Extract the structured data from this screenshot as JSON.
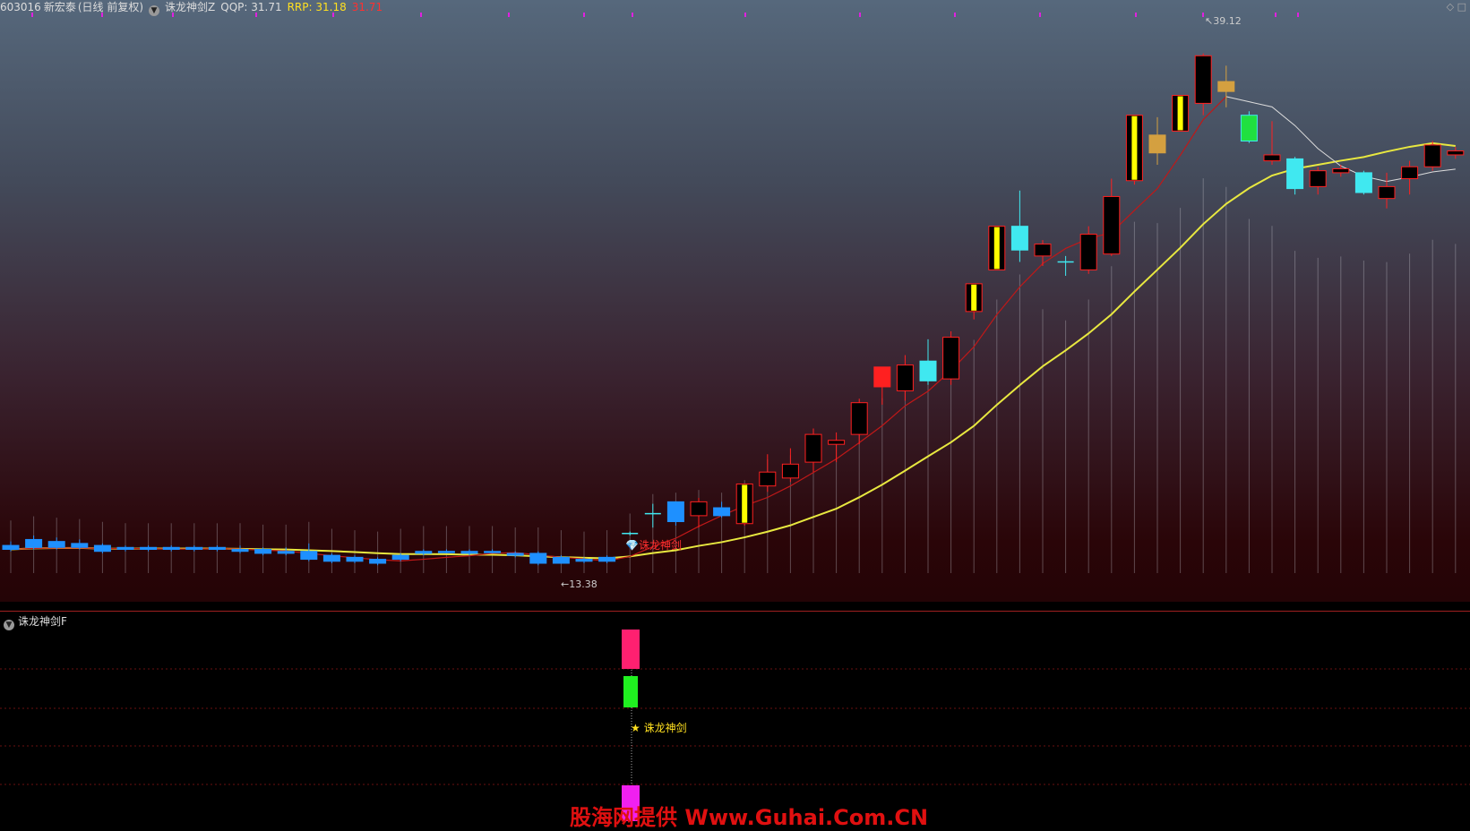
{
  "header": {
    "stock_code": "603016",
    "stock_name": "新宏泰",
    "period": "(日线 前复权)",
    "indicator": "诛龙神剑Z",
    "qqp_label": "QQP: 31.71",
    "rrp_label": "RRP: 31.18",
    "extra_value": "31.71"
  },
  "main_chart": {
    "high_label": "39.12",
    "low_label": "13.38",
    "signal_label": "诛龙神剑"
  },
  "sub_panel": {
    "title": "诛龙神剑F",
    "signal_label": "诛龙神剑"
  },
  "watermark": "股海网提供 Www.Guhai.Com.CN",
  "colors": {
    "up": "#ff2020",
    "down_blue": "#1e90ff",
    "cyan": "#40e8f0",
    "yellow_bar": "#ffff00",
    "ma_yellow": "#e8e840",
    "ma_red": "#c01818",
    "accent_magenta": "#e020e0"
  },
  "chart_data": {
    "type": "candlestick",
    "ylim": [
      12.0,
      41.0
    ],
    "candles": [
      {
        "o": 14.3,
        "c": 14.1,
        "h": 14.5,
        "l": 14.0,
        "kind": "down"
      },
      {
        "o": 14.6,
        "c": 14.2,
        "h": 14.8,
        "l": 14.1,
        "kind": "down"
      },
      {
        "o": 14.5,
        "c": 14.2,
        "h": 14.7,
        "l": 14.1,
        "kind": "down"
      },
      {
        "o": 14.4,
        "c": 14.2,
        "h": 14.6,
        "l": 14.1,
        "kind": "down"
      },
      {
        "o": 14.3,
        "c": 14.0,
        "h": 14.4,
        "l": 13.9,
        "kind": "down"
      },
      {
        "o": 14.2,
        "c": 14.1,
        "h": 14.3,
        "l": 14.0,
        "kind": "down"
      },
      {
        "o": 14.1,
        "c": 14.2,
        "h": 14.3,
        "l": 14.0,
        "kind": "down"
      },
      {
        "o": 14.2,
        "c": 14.1,
        "h": 14.3,
        "l": 14.0,
        "kind": "down"
      },
      {
        "o": 14.1,
        "c": 14.2,
        "h": 14.3,
        "l": 14.0,
        "kind": "down"
      },
      {
        "o": 14.2,
        "c": 14.1,
        "h": 14.3,
        "l": 14.0,
        "kind": "down"
      },
      {
        "o": 14.1,
        "c": 14.0,
        "h": 14.3,
        "l": 13.9,
        "kind": "down"
      },
      {
        "o": 14.1,
        "c": 13.9,
        "h": 14.2,
        "l": 13.8,
        "kind": "down"
      },
      {
        "o": 14.0,
        "c": 13.9,
        "h": 14.2,
        "l": 13.8,
        "kind": "down"
      },
      {
        "o": 14.0,
        "c": 13.6,
        "h": 14.4,
        "l": 13.5,
        "kind": "down"
      },
      {
        "o": 13.8,
        "c": 13.5,
        "h": 13.9,
        "l": 13.4,
        "kind": "down"
      },
      {
        "o": 13.7,
        "c": 13.5,
        "h": 13.8,
        "l": 13.4,
        "kind": "down"
      },
      {
        "o": 13.6,
        "c": 13.4,
        "h": 13.7,
        "l": 13.3,
        "kind": "down"
      },
      {
        "o": 13.8,
        "c": 13.6,
        "h": 13.9,
        "l": 13.5,
        "kind": "down"
      },
      {
        "o": 13.9,
        "c": 14.0,
        "h": 14.1,
        "l": 13.8,
        "kind": "down"
      },
      {
        "o": 14.0,
        "c": 14.0,
        "h": 14.1,
        "l": 13.9,
        "kind": "down"
      },
      {
        "o": 14.0,
        "c": 13.9,
        "h": 14.1,
        "l": 13.8,
        "kind": "down"
      },
      {
        "o": 14.0,
        "c": 14.0,
        "h": 14.1,
        "l": 13.9,
        "kind": "down"
      },
      {
        "o": 13.9,
        "c": 13.8,
        "h": 14.0,
        "l": 13.7,
        "kind": "down"
      },
      {
        "o": 13.9,
        "c": 13.4,
        "h": 14.0,
        "l": 13.3,
        "kind": "down"
      },
      {
        "o": 13.7,
        "c": 13.4,
        "h": 13.8,
        "l": 13.38,
        "kind": "down"
      },
      {
        "o": 13.6,
        "c": 13.5,
        "h": 13.7,
        "l": 13.4,
        "kind": "down"
      },
      {
        "o": 13.7,
        "c": 13.5,
        "h": 13.8,
        "l": 13.4,
        "kind": "down"
      },
      {
        "o": 14.9,
        "c": 14.9,
        "h": 15.0,
        "l": 14.8,
        "kind": "doji"
      },
      {
        "o": 15.9,
        "c": 15.9,
        "h": 16.4,
        "l": 15.2,
        "kind": "doji"
      },
      {
        "o": 16.5,
        "c": 15.5,
        "h": 16.5,
        "l": 15.3,
        "kind": "down"
      },
      {
        "o": 15.8,
        "c": 16.5,
        "h": 16.7,
        "l": 15.2,
        "kind": "hollow"
      },
      {
        "o": 15.8,
        "c": 16.2,
        "h": 16.5,
        "l": 15.7,
        "kind": "down"
      },
      {
        "o": 15.4,
        "c": 17.4,
        "h": 17.4,
        "l": 15.3,
        "kind": "yellow"
      },
      {
        "o": 17.3,
        "c": 18.0,
        "h": 18.9,
        "l": 17.0,
        "kind": "hollow"
      },
      {
        "o": 17.7,
        "c": 18.4,
        "h": 19.2,
        "l": 17.5,
        "kind": "hollow"
      },
      {
        "o": 18.5,
        "c": 19.9,
        "h": 20.2,
        "l": 18.0,
        "kind": "hollow"
      },
      {
        "o": 19.4,
        "c": 19.6,
        "h": 20.0,
        "l": 18.5,
        "kind": "hollow"
      },
      {
        "o": 19.9,
        "c": 21.5,
        "h": 21.7,
        "l": 19.4,
        "kind": "hollow"
      },
      {
        "o": 23.3,
        "c": 22.3,
        "h": 23.3,
        "l": 21.4,
        "kind": "red"
      },
      {
        "o": 22.1,
        "c": 23.4,
        "h": 23.9,
        "l": 21.6,
        "kind": "hollow"
      },
      {
        "o": 22.6,
        "c": 23.6,
        "h": 24.7,
        "l": 22.4,
        "kind": "cyan"
      },
      {
        "o": 22.7,
        "c": 24.8,
        "h": 25.1,
        "l": 22.4,
        "kind": "hollow"
      },
      {
        "o": 26.1,
        "c": 27.5,
        "h": 27.5,
        "l": 25.7,
        "kind": "yellow"
      },
      {
        "o": 28.2,
        "c": 30.4,
        "h": 30.4,
        "l": 28.2,
        "kind": "yellow"
      },
      {
        "o": 29.2,
        "c": 30.4,
        "h": 32.2,
        "l": 28.6,
        "kind": "cyan"
      },
      {
        "o": 28.9,
        "c": 29.5,
        "h": 29.7,
        "l": 28.4,
        "kind": "hollow"
      },
      {
        "o": 28.6,
        "c": 28.6,
        "h": 28.9,
        "l": 27.9,
        "kind": "doji"
      },
      {
        "o": 28.2,
        "c": 30.0,
        "h": 30.4,
        "l": 28.0,
        "kind": "hollow"
      },
      {
        "o": 29.0,
        "c": 31.9,
        "h": 32.8,
        "l": 28.9,
        "kind": "hollow"
      },
      {
        "o": 32.7,
        "c": 36.0,
        "h": 36.0,
        "l": 32.5,
        "kind": "yellow"
      },
      {
        "o": 34.1,
        "c": 35.0,
        "h": 35.9,
        "l": 33.5,
        "kind": "gold"
      },
      {
        "o": 35.2,
        "c": 37.0,
        "h": 37.0,
        "l": 35.2,
        "kind": "yellow"
      },
      {
        "o": 36.6,
        "c": 39.0,
        "h": 39.12,
        "l": 36.0,
        "kind": "hollow"
      },
      {
        "o": 37.2,
        "c": 37.7,
        "h": 38.5,
        "l": 36.4,
        "kind": "gold"
      },
      {
        "o": 36.0,
        "c": 34.7,
        "h": 36.2,
        "l": 34.6,
        "kind": "green"
      },
      {
        "o": 34.0,
        "c": 33.7,
        "h": 35.7,
        "l": 33.5,
        "kind": "hollow"
      },
      {
        "o": 33.8,
        "c": 32.3,
        "h": 33.9,
        "l": 32.0,
        "kind": "cyan"
      },
      {
        "o": 32.4,
        "c": 33.2,
        "h": 33.4,
        "l": 32.0,
        "kind": "hollow"
      },
      {
        "o": 33.1,
        "c": 33.3,
        "h": 33.5,
        "l": 32.9,
        "kind": "hollow"
      },
      {
        "o": 33.1,
        "c": 32.1,
        "h": 33.2,
        "l": 32.0,
        "kind": "cyan"
      },
      {
        "o": 31.8,
        "c": 32.4,
        "h": 33.1,
        "l": 31.3,
        "kind": "hollow"
      },
      {
        "o": 32.8,
        "c": 33.4,
        "h": 33.7,
        "l": 32.0,
        "kind": "hollow"
      },
      {
        "o": 33.4,
        "c": 34.5,
        "h": 34.7,
        "l": 33.2,
        "kind": "hollow"
      },
      {
        "o": 34.2,
        "c": 34.0,
        "h": 34.4,
        "l": 33.8,
        "kind": "hollow"
      }
    ]
  }
}
